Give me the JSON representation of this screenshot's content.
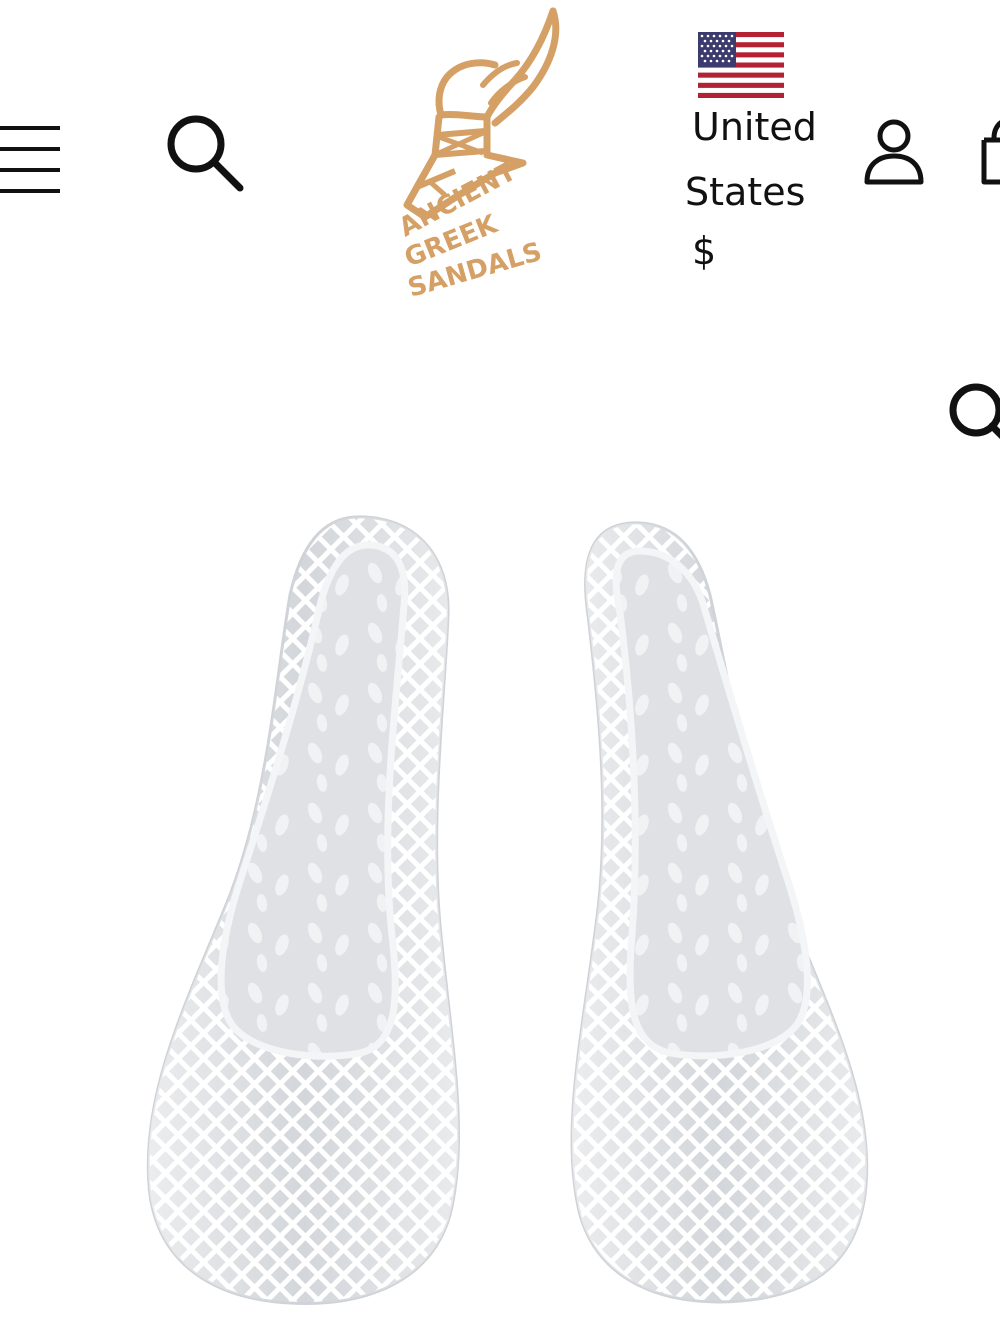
{
  "header": {
    "logo": {
      "brand_lines": [
        "ANCIENT",
        "GREEK",
        "SANDALS"
      ],
      "icon": "winged-sandal-logo",
      "color": "#d5a065"
    },
    "menu_icon": "hamburger-menu-icon",
    "search_icon": "search-icon",
    "locale": {
      "flag_icon": "us-flag-icon",
      "country_line1": "United",
      "country_line2": "States",
      "currency": "$"
    },
    "account_icon": "account-icon",
    "cart_icon": "shopping-bag-icon"
  },
  "secondary_search_icon": "search-icon",
  "product": {
    "image": "clear-jelly-ballet-flats-product-image"
  }
}
